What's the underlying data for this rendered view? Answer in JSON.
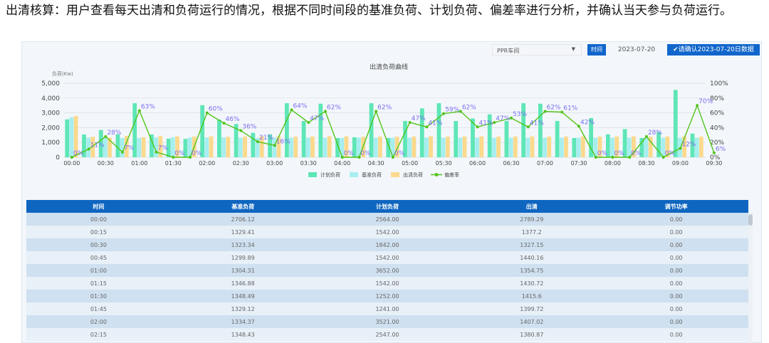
{
  "caption": "出清核算：用户查看每天出清和负荷运行的情况，根据不同时间段的基准负荷、计划负荷、偏差率进行分析，并确认当天参与负荷运行。",
  "toolbar": {
    "select_value": "PPR车间",
    "time_label": "时间",
    "date_value": "2023-07-20",
    "confirm_label": "✔请确认2023-07-20日数据"
  },
  "chart_data": {
    "type": "bar",
    "title": "出清负荷曲线",
    "ylabel": "负荷(Kw)",
    "ylim": [
      0,
      5000
    ],
    "yticks": [
      "0",
      "1,000",
      "2,000",
      "3,000",
      "4,000",
      "5,000"
    ],
    "y2lim": [
      0,
      100
    ],
    "y2ticks": [
      "0%",
      "20%",
      "40%",
      "60%",
      "80%",
      "100%"
    ],
    "xticks": [
      "00:00",
      "00:30",
      "01:00",
      "01:30",
      "02:00",
      "02:30",
      "03:00",
      "03:30",
      "04:00",
      "04:30",
      "05:00",
      "05:30",
      "06:00",
      "06:30",
      "07:00",
      "07:30",
      "08:00",
      "08:30",
      "09:00",
      "09:30"
    ],
    "colors": {
      "plan": "#5ee6b6",
      "base": "#a6eef0",
      "clear": "#fbd98d",
      "rate": "#52c41a",
      "rate_label": "#7a6ff0"
    },
    "series": [
      {
        "name": "计划负荷",
        "type": "bar",
        "values": [
          2564,
          1542,
          1842,
          1542,
          3652,
          1542,
          1252,
          1241,
          3521,
          2547,
          2250,
          1650,
          1550,
          3652,
          2450,
          3620,
          1300,
          1350,
          3650,
          1300,
          2450,
          3300,
          3652,
          2450,
          2620,
          2900,
          2450,
          3652,
          3620,
          2450,
          1300,
          2650,
          1550,
          1900,
          1300,
          1700,
          4550,
          1600
        ]
      },
      {
        "name": "基准负荷",
        "type": "bar",
        "values": [
          2706,
          1329,
          1323,
          1300,
          1304,
          1347,
          1348,
          1329,
          1334,
          1348,
          1320,
          1300,
          1330,
          1310,
          1330,
          1320,
          1310,
          1330,
          1320,
          1320,
          1320,
          1330,
          1320,
          1320,
          1320,
          1320,
          1320,
          1320,
          1320,
          1320,
          1320,
          1320,
          1320,
          1320,
          1320,
          1320,
          1320,
          1320
        ]
      },
      {
        "name": "出清负荷",
        "type": "bar",
        "values": [
          2789,
          1377,
          1327,
          1440,
          1355,
          1431,
          1416,
          1400,
          1407,
          1381,
          1400,
          1420,
          1410,
          1390,
          1400,
          1420,
          1410,
          1380,
          1400,
          1390,
          1400,
          1410,
          1390,
          1400,
          1410,
          1390,
          1400,
          1410,
          1390,
          1400,
          1410,
          1390,
          1400,
          1410,
          1390,
          1400,
          1410,
          1390
        ]
      },
      {
        "name": "偏差率",
        "type": "line",
        "values": [
          0,
          11,
          28,
          7,
          63,
          7,
          0,
          0,
          60,
          46,
          36,
          21,
          16,
          64,
          47,
          62,
          0,
          0,
          62,
          0,
          47,
          41,
          59,
          62,
          41,
          47,
          53,
          41,
          62,
          61,
          42,
          0,
          0,
          0,
          28,
          0,
          12,
          70,
          6
        ]
      }
    ],
    "rate_labels": [
      "0%",
      "11%",
      "28%",
      "7%",
      "63%",
      "7%",
      "0%",
      "0%",
      "60%",
      "46%",
      "36%",
      "21%",
      "16%",
      "64%",
      "47%",
      "62%",
      "0%",
      "0%",
      "62%",
      "0%",
      "47%",
      "41%",
      "59%",
      "62%",
      "41%",
      "47%",
      "53%",
      "41%",
      "62%",
      "61%",
      "42%",
      "0%",
      "0%",
      "0%",
      "28%",
      "0%",
      "12%",
      "70%",
      "6%"
    ]
  },
  "table": {
    "headers": [
      "时间",
      "基准负荷",
      "计划负荷",
      "出清",
      "调节功率"
    ],
    "rows": [
      [
        "00:00",
        "2706.12",
        "2564.00",
        "2789.29",
        "0.00"
      ],
      [
        "00:15",
        "1329.41",
        "1542.00",
        "1377.2",
        "0.00"
      ],
      [
        "00:30",
        "1323.34",
        "1842.00",
        "1327.15",
        "0.00"
      ],
      [
        "00:45",
        "1299.89",
        "1542.00",
        "1440.16",
        "0.00"
      ],
      [
        "01:00",
        "1304.31",
        "3652.00",
        "1354.75",
        "0.00"
      ],
      [
        "01:15",
        "1346.88",
        "1542.00",
        "1430.72",
        "0.00"
      ],
      [
        "01:30",
        "1348.49",
        "1252.00",
        "1415.6",
        "0.00"
      ],
      [
        "01:45",
        "1329.12",
        "1241.00",
        "1399.72",
        "0.00"
      ],
      [
        "02:00",
        "1334.37",
        "3521.00",
        "1407.02",
        "0.00"
      ],
      [
        "02:15",
        "1348.43",
        "2547.00",
        "1380.87",
        "0.00"
      ]
    ]
  }
}
